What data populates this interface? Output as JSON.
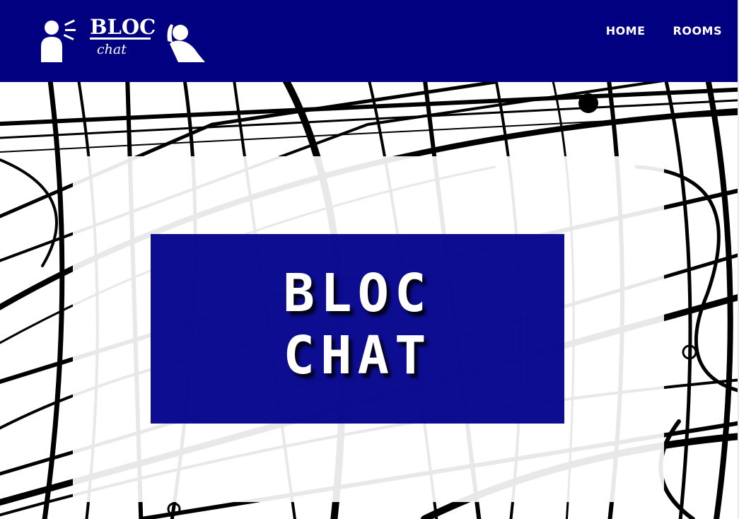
{
  "header": {
    "logo_title": "BLOC",
    "logo_subtitle": "chat",
    "nav": [
      {
        "label": "HOME"
      },
      {
        "label": "ROOMS"
      }
    ]
  },
  "hero": {
    "title_line1": "BLOC",
    "title_line2": "CHAT"
  },
  "colors": {
    "navbar": "#000080",
    "title_box": "#00008c",
    "text": "#ffffff",
    "wires": "#000000"
  },
  "icons": [
    "speaking-person-icon",
    "listening-person-icon"
  ]
}
